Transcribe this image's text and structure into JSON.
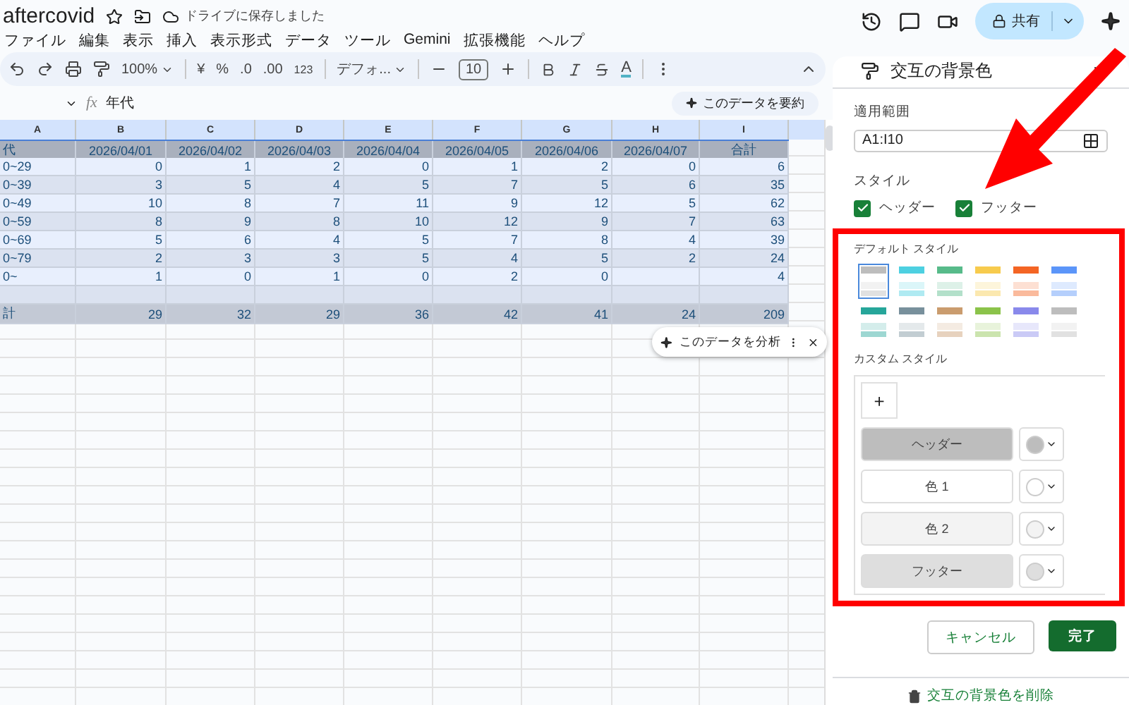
{
  "document": {
    "title": "aftercovid",
    "save_status": "ドライブに保存しました"
  },
  "menu": [
    "ファイル",
    "編集",
    "表示",
    "挿入",
    "表示形式",
    "データ",
    "ツール",
    "Gemini",
    "拡張機能",
    "ヘルプ"
  ],
  "share_button": {
    "label": "共有"
  },
  "toolbar": {
    "zoom": "100%",
    "currency": "¥",
    "percent": "%",
    "decrease_decimal": ".0",
    "increase_decimal": ".00",
    "number_format": "123",
    "font": "デフォ...",
    "font_size": "10",
    "text_color": "A"
  },
  "formula_bar": {
    "label": "fx",
    "value": "年代"
  },
  "summarize_button": "このデータを要約",
  "sheet": {
    "column_headers": [
      "A",
      "B",
      "C",
      "D",
      "E",
      "F",
      "G",
      "H",
      "I"
    ],
    "rows": [
      {
        "kind": "header",
        "cells": [
          "代",
          "2026/04/01",
          "2026/04/02",
          "2026/04/03",
          "2026/04/04",
          "2026/04/05",
          "2026/04/06",
          "2026/04/07",
          "合計"
        ]
      },
      {
        "kind": "band",
        "cells": [
          "0~29",
          "0",
          "1",
          "2",
          "0",
          "1",
          "2",
          "0",
          "6"
        ]
      },
      {
        "kind": "band",
        "cells": [
          "0~39",
          "3",
          "5",
          "4",
          "5",
          "7",
          "5",
          "6",
          "35"
        ]
      },
      {
        "kind": "band",
        "cells": [
          "0~49",
          "10",
          "8",
          "7",
          "11",
          "9",
          "12",
          "5",
          "62"
        ]
      },
      {
        "kind": "band",
        "cells": [
          "0~59",
          "8",
          "9",
          "8",
          "10",
          "12",
          "9",
          "7",
          "63"
        ]
      },
      {
        "kind": "band",
        "cells": [
          "0~69",
          "5",
          "6",
          "4",
          "5",
          "7",
          "8",
          "4",
          "39"
        ]
      },
      {
        "kind": "band",
        "cells": [
          "0~79",
          "2",
          "3",
          "3",
          "5",
          "4",
          "5",
          "2",
          "24"
        ]
      },
      {
        "kind": "band",
        "cells": [
          "0~",
          "1",
          "0",
          "1",
          "0",
          "2",
          "0",
          null,
          "4"
        ]
      },
      {
        "kind": "band",
        "cells": [
          null,
          null,
          null,
          null,
          null,
          null,
          null,
          null,
          null
        ]
      },
      {
        "kind": "footer",
        "cells": [
          "計",
          "29",
          "32",
          "29",
          "36",
          "42",
          "41",
          "24",
          "209"
        ]
      }
    ]
  },
  "analyze_chip": {
    "label": "このデータを分析"
  },
  "panel": {
    "title": "交互の背景色",
    "range_label": "適用範囲",
    "range_value": "A1:I10",
    "style_label": "スタイル",
    "options": [
      {
        "label": "ヘッダー",
        "checked": true
      },
      {
        "label": "フッター",
        "checked": true
      }
    ],
    "default_styles_label": "デフォルト スタイル",
    "default_styles": [
      {
        "color": "#bdbdbd",
        "selected": true
      },
      {
        "color": "#4dd0e1",
        "selected": false
      },
      {
        "color": "#57bb8a",
        "selected": false
      },
      {
        "color": "#f7cb4d",
        "selected": false
      },
      {
        "color": "#f46524",
        "selected": false
      },
      {
        "color": "#5b95f9",
        "selected": false
      },
      {
        "color": "#26a69a",
        "selected": false
      },
      {
        "color": "#78909c",
        "selected": false
      },
      {
        "color": "#ca9c6e",
        "selected": false
      },
      {
        "color": "#8bc34a",
        "selected": false
      },
      {
        "color": "#8989eb",
        "selected": false
      },
      {
        "color": "#bdbdbd",
        "selected": false
      }
    ],
    "custom_styles_label": "カスタム スタイル",
    "add_button": "+",
    "custom_colors": [
      {
        "label": "ヘッダー",
        "color": "#bdbdbd"
      },
      {
        "label": "色 1",
        "color": "#ffffff"
      },
      {
        "label": "色 2",
        "color": "#f3f3f3"
      },
      {
        "label": "フッター",
        "color": "#dedede"
      }
    ],
    "cancel_button": "キャンセル",
    "done_button": "完了",
    "remove_link": "交互の背景色を削除"
  }
}
